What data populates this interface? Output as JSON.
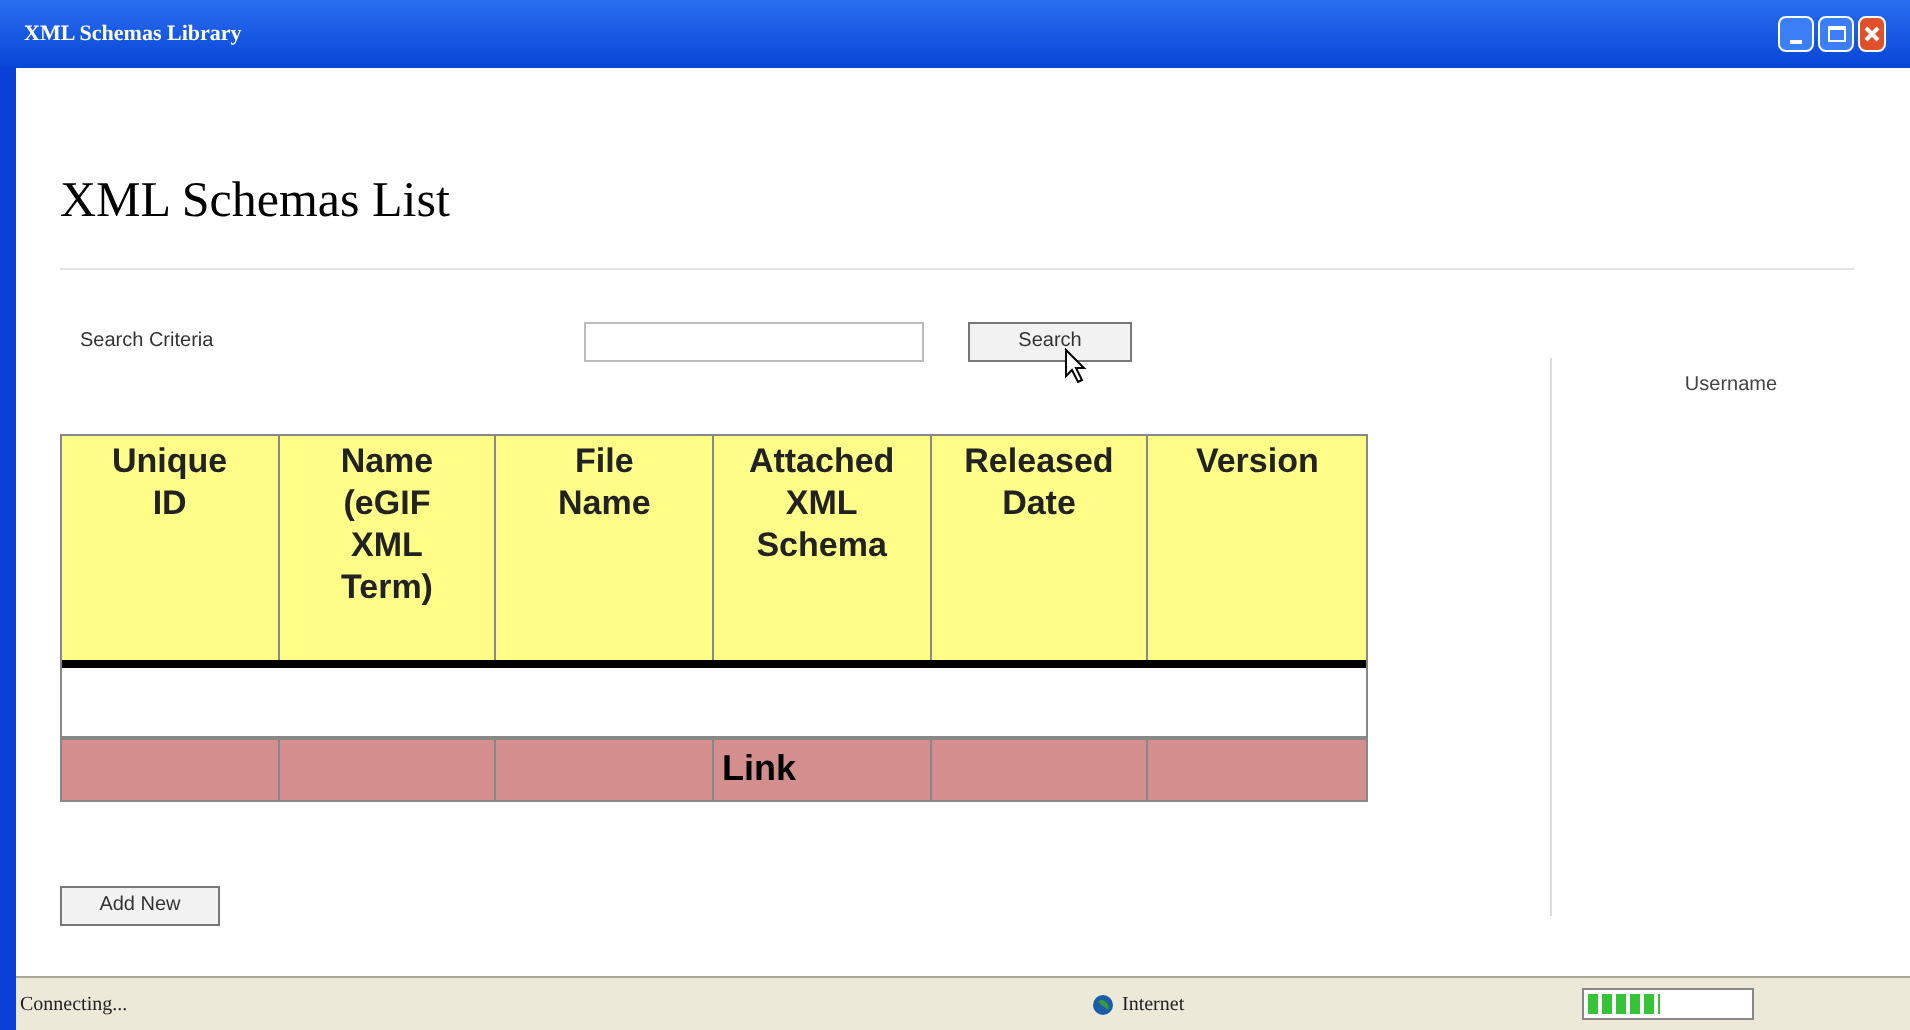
{
  "window": {
    "title": "XML Schemas Library"
  },
  "page_title": "XML Schemas List",
  "search": {
    "label": "Search Criteria",
    "button": "Search"
  },
  "user": {
    "label": "Username"
  },
  "table": {
    "columns": [
      "Unique ID",
      "Name (eGIF XML Term)",
      "File Name",
      "Attached XML Schema",
      "Released Date",
      "Version"
    ],
    "rows": [
      {
        "kind": "blank",
        "cells": [
          "",
          "",
          "",
          "",
          "",
          ""
        ]
      },
      {
        "kind": "link",
        "cells": [
          "",
          "",
          "",
          "Link",
          "",
          ""
        ]
      }
    ]
  },
  "add_button": "Add New",
  "status_bar": {
    "status": "Connecting...",
    "zone": "Internet",
    "progress": {
      "level": 0.45
    }
  }
}
